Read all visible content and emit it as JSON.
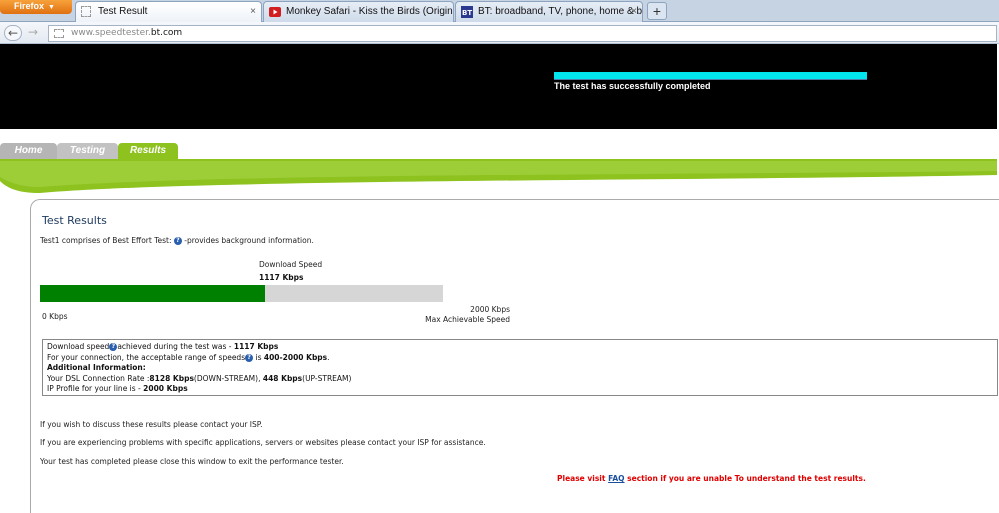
{
  "browser": {
    "menu_button": "Firefox",
    "tabs": [
      {
        "title": "Test Result"
      },
      {
        "title": "Monkey Safari - Kiss the Birds (Origin..."
      },
      {
        "title": "BT: broadband, TV, phone, home & b..."
      }
    ],
    "new_tab": "+",
    "close_glyph": "×",
    "url_scheme": "www.speedtester.",
    "url_host": "bt.com",
    "back_glyph": "←",
    "forward_glyph": "→"
  },
  "banner": {
    "message": "The test has successfully completed",
    "progress_fraction": 1.0
  },
  "nav": {
    "home": "Home",
    "testing": "Testing",
    "results": "Results"
  },
  "results": {
    "title": "Test Results",
    "intro_before": "Test1 comprises of Best Effort Test: ",
    "intro_after": " -provides background information.",
    "download_label": "Download  Speed",
    "download_value": "1117 Kbps",
    "download_fraction": 0.5585,
    "min_label": "0 Kbps",
    "max_value": "2000 Kbps",
    "max_label": "Max Achievable Speed"
  },
  "info": {
    "line1_a": "Download speed",
    "line1_b": "achieved during the test was - ",
    "line1_val": "1117 Kbps",
    "line2_a": "For your connection, the acceptable range of speeds",
    "line2_b": " is ",
    "line2_val": "400-2000 Kbps",
    "line2_end": ".",
    "heading": "Additional Information:",
    "line4_a": "Your DSL Connection Rate :",
    "line4_down": "8128 Kbps",
    "line4_down_lbl": "(DOWN-STREAM), ",
    "line4_up": "448 Kbps",
    "line4_up_lbl": "(UP-STREAM)",
    "line5_a": "IP Profile for your line is - ",
    "line5_val": "2000 Kbps"
  },
  "footer": {
    "para1": "If you wish to discuss these results please contact your ISP.",
    "para2": "If you are experiencing problems with specific applications, servers or websites please contact your ISP for assistance.",
    "para3": "Your test has completed please close this window to exit the performance tester.",
    "faq_before": "Please visit ",
    "faq_link": "FAQ",
    "faq_after": " section if you are unable To understand the test results."
  },
  "colors": {
    "accent_green": "#8dc21f",
    "bar_fill": "#008000",
    "progress_cyan": "#00e5ee",
    "warning_red": "#e00000"
  }
}
